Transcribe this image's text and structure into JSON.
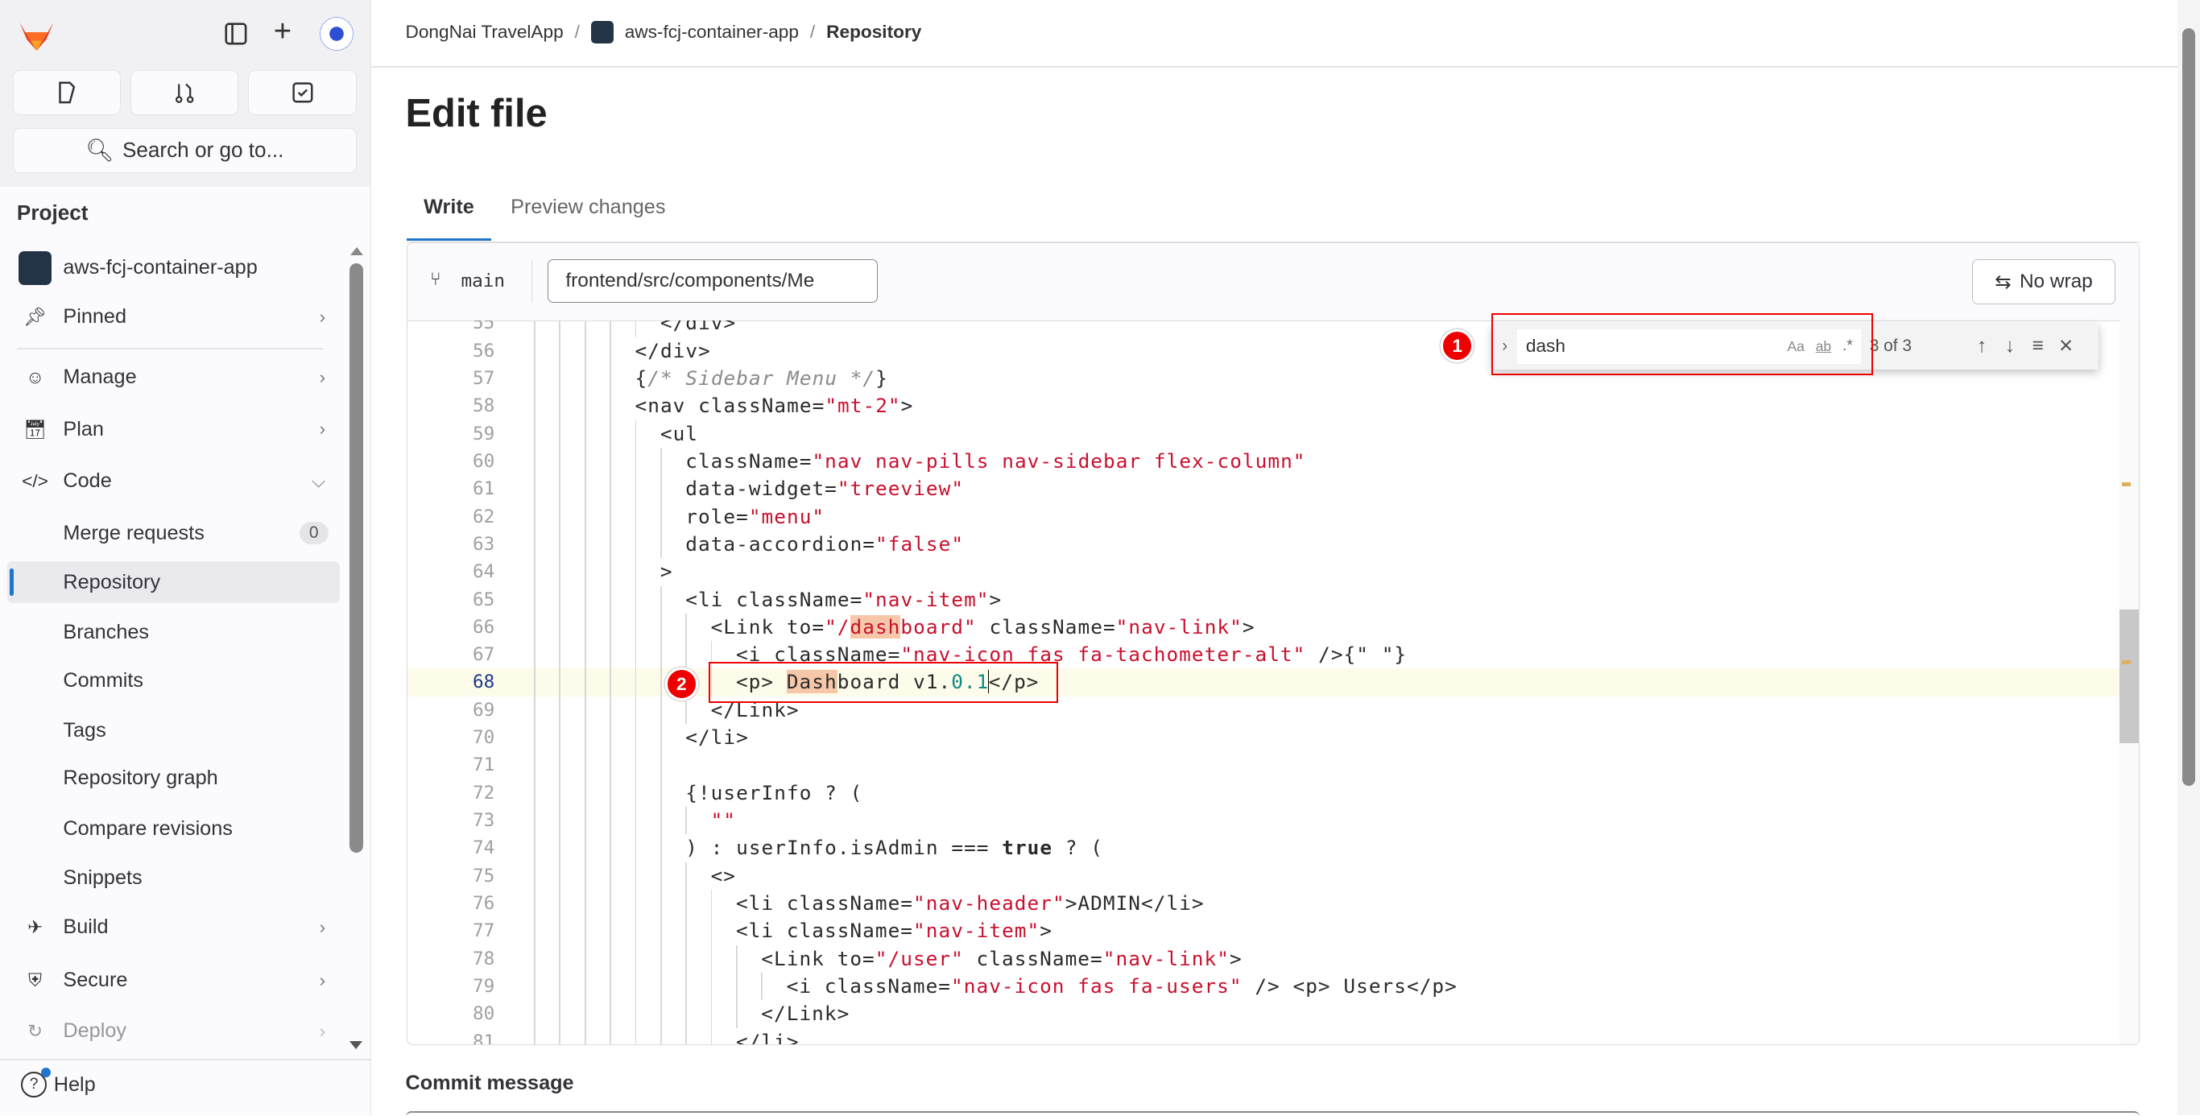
{
  "sidebar": {
    "search_label": "Search or go to...",
    "section_title": "Project",
    "project_name": "aws-fcj-container-app",
    "items": [
      {
        "label": "Pinned",
        "icon": "pin-icon",
        "chevron": ">"
      },
      {
        "label": "Manage",
        "icon": "users-icon",
        "chevron": ">"
      },
      {
        "label": "Plan",
        "icon": "calendar-icon",
        "chevron": ">"
      },
      {
        "label": "Code",
        "icon": "code-icon",
        "chevron": "v"
      },
      {
        "label": "Merge requests",
        "badge": "0"
      },
      {
        "label": "Repository",
        "active": true
      },
      {
        "label": "Branches"
      },
      {
        "label": "Commits"
      },
      {
        "label": "Tags"
      },
      {
        "label": "Repository graph"
      },
      {
        "label": "Compare revisions"
      },
      {
        "label": "Snippets"
      },
      {
        "label": "Build",
        "icon": "rocket-icon",
        "chevron": ">"
      },
      {
        "label": "Secure",
        "icon": "shield-icon",
        "chevron": ">"
      },
      {
        "label": "Deploy",
        "icon": "deploy-icon",
        "chevron": ">"
      }
    ],
    "help_label": "Help"
  },
  "breadcrumb": [
    "DongNai TravelApp",
    "aws-fcj-container-app",
    "Repository"
  ],
  "page_title": "Edit file",
  "tabs": [
    {
      "label": "Write",
      "active": true
    },
    {
      "label": "Preview changes"
    }
  ],
  "editor": {
    "branch": "main",
    "file_path": "frontend/src/components/Me",
    "wrap_label": "No wrap",
    "find": {
      "query": "dash",
      "match_case": "Aa",
      "whole_word": "ab",
      "regex": ".*",
      "count": "3 of 3"
    },
    "current_line": 68,
    "lines": [
      {
        "n": 55,
        "indent": 10,
        "t": [
          [
            "</div>",
            ""
          ]
        ]
      },
      {
        "n": 56,
        "indent": 8,
        "t": [
          [
            "</div>",
            ""
          ]
        ]
      },
      {
        "n": 57,
        "indent": 8,
        "t": [
          [
            "{",
            ""
          ],
          [
            "/* Sidebar Menu */",
            "c"
          ],
          [
            "}",
            ""
          ]
        ]
      },
      {
        "n": 58,
        "indent": 8,
        "t": [
          [
            "<nav className=",
            ""
          ],
          [
            "\"mt-2\"",
            "s"
          ],
          [
            ">",
            ""
          ]
        ]
      },
      {
        "n": 59,
        "indent": 10,
        "t": [
          [
            "<ul",
            ""
          ]
        ]
      },
      {
        "n": 60,
        "indent": 12,
        "t": [
          [
            "className=",
            ""
          ],
          [
            "\"nav nav-pills nav-sidebar flex-column\"",
            "s"
          ]
        ]
      },
      {
        "n": 61,
        "indent": 12,
        "t": [
          [
            "data-widget=",
            ""
          ],
          [
            "\"treeview\"",
            "s"
          ]
        ]
      },
      {
        "n": 62,
        "indent": 12,
        "t": [
          [
            "role=",
            ""
          ],
          [
            "\"menu\"",
            "s"
          ]
        ]
      },
      {
        "n": 63,
        "indent": 12,
        "t": [
          [
            "data-accordion=",
            ""
          ],
          [
            "\"false\"",
            "s"
          ]
        ]
      },
      {
        "n": 64,
        "indent": 10,
        "t": [
          [
            ">",
            ""
          ]
        ]
      },
      {
        "n": 65,
        "indent": 12,
        "t": [
          [
            "<li className=",
            ""
          ],
          [
            "\"nav-item\"",
            "s"
          ],
          [
            ">",
            ""
          ]
        ]
      },
      {
        "n": 66,
        "indent": 14,
        "t": [
          [
            "<Link to=",
            ""
          ],
          [
            "\"/",
            "s"
          ],
          [
            "dash",
            "s hl"
          ],
          [
            "board\"",
            "s"
          ],
          [
            " className=",
            ""
          ],
          [
            "\"nav-link\"",
            "s"
          ],
          [
            ">",
            ""
          ]
        ]
      },
      {
        "n": 67,
        "indent": 16,
        "t": [
          [
            "<i className=",
            ""
          ],
          [
            "\"nav-icon fas fa-tachometer-alt\"",
            "s"
          ],
          [
            " />{\" \"}",
            ""
          ]
        ]
      },
      {
        "n": 68,
        "indent": 16,
        "t": [
          [
            "<p> ",
            ""
          ],
          [
            "Dash",
            "hl"
          ],
          [
            "board v1.",
            ""
          ],
          [
            "0.1",
            "n"
          ],
          [
            "</p>",
            ""
          ]
        ]
      },
      {
        "n": 69,
        "indent": 14,
        "t": [
          [
            "</Link>",
            ""
          ]
        ]
      },
      {
        "n": 70,
        "indent": 12,
        "t": [
          [
            "</li>",
            ""
          ]
        ]
      },
      {
        "n": 71,
        "indent": 0,
        "t": []
      },
      {
        "n": 72,
        "indent": 12,
        "t": [
          [
            "{!userInfo ? (",
            ""
          ]
        ]
      },
      {
        "n": 73,
        "indent": 14,
        "t": [
          [
            "\"\"",
            "s"
          ]
        ]
      },
      {
        "n": 74,
        "indent": 12,
        "t": [
          [
            ") : userInfo.isAdmin === ",
            ""
          ],
          [
            "true",
            "k"
          ],
          [
            " ? (",
            ""
          ]
        ]
      },
      {
        "n": 75,
        "indent": 14,
        "t": [
          [
            "<>",
            ""
          ]
        ]
      },
      {
        "n": 76,
        "indent": 16,
        "t": [
          [
            "<li className=",
            ""
          ],
          [
            "\"nav-header\"",
            "s"
          ],
          [
            ">ADMIN</li>",
            ""
          ]
        ]
      },
      {
        "n": 77,
        "indent": 16,
        "t": [
          [
            "<li className=",
            ""
          ],
          [
            "\"nav-item\"",
            "s"
          ],
          [
            ">",
            ""
          ]
        ]
      },
      {
        "n": 78,
        "indent": 18,
        "t": [
          [
            "<Link to=",
            ""
          ],
          [
            "\"/user\"",
            "s"
          ],
          [
            " className=",
            ""
          ],
          [
            "\"nav-link\"",
            "s"
          ],
          [
            ">",
            ""
          ]
        ]
      },
      {
        "n": 79,
        "indent": 20,
        "t": [
          [
            "<i className=",
            ""
          ],
          [
            "\"nav-icon fas fa-users\"",
            "s"
          ],
          [
            " /> <p> Users</p>",
            ""
          ]
        ]
      },
      {
        "n": 80,
        "indent": 18,
        "t": [
          [
            "</Link>",
            ""
          ]
        ]
      },
      {
        "n": 81,
        "indent": 16,
        "t": [
          [
            "</li>",
            ""
          ]
        ]
      }
    ]
  },
  "annotations": [
    "1",
    "2"
  ],
  "commit_label": "Commit message",
  "colors": {
    "accent": "#1f75cb",
    "annotation": "#ee0000",
    "string": "#c8102e",
    "match": "#f6c7a8"
  }
}
